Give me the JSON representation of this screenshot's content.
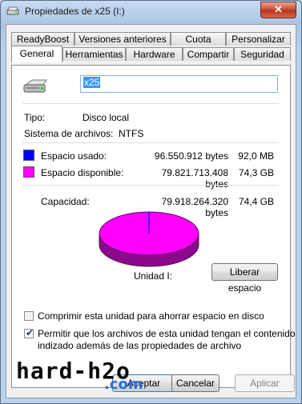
{
  "window": {
    "title": "Propiedades de x25 (I:)",
    "close_label": "✕"
  },
  "tabs_row1": [
    "ReadyBoost",
    "Versiones anteriores",
    "Cuota",
    "Personalizar"
  ],
  "tabs_row2": [
    "General",
    "Herramientas",
    "Hardware",
    "Compartir",
    "Seguridad"
  ],
  "active_tab": "General",
  "general": {
    "volume_name": "x25",
    "type_label": "Tipo:",
    "type_value": "Disco local",
    "fs_label": "Sistema de archivos:",
    "fs_value": "NTFS",
    "used_label": "Espacio usado:",
    "used_bytes": "96.550.912 bytes",
    "used_short": "92,0 MB",
    "free_label": "Espacio disponible:",
    "free_bytes": "79.821.713.408 bytes",
    "free_short": "74,3 GB",
    "capacity_label": "Capacidad:",
    "capacity_bytes": "79.918.264.320 bytes",
    "capacity_short": "74,4 GB",
    "drive_label": "Unidad I:",
    "cleanup_button": "Liberar espacio",
    "compress_label": "Comprimir esta unidad para ahorrar espacio en disco",
    "compress_checked": false,
    "index_label_line1": "Permitir que los archivos de esta unidad tengan el contenido",
    "index_label_line2": "indizado además de las propiedades de archivo",
    "index_checked": true
  },
  "colors": {
    "used": "#0000ff",
    "free": "#ff00ff",
    "free_side": "#8b0a8b"
  },
  "chart_data": {
    "type": "pie",
    "categories": [
      "Espacio usado",
      "Espacio disponible"
    ],
    "values": [
      96550912,
      79821713408
    ]
  },
  "buttons": {
    "ok": "Aceptar",
    "cancel": "Cancelar",
    "apply": "Aplicar"
  },
  "watermark": {
    "line1": "hard-h2o",
    "line2": ".com"
  }
}
